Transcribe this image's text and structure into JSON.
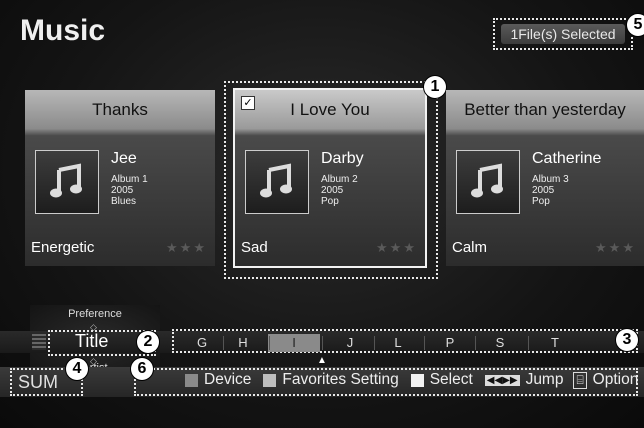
{
  "page_title": "Music",
  "selection_status": "1File(s) Selected",
  "callouts": {
    "c1": "1",
    "c2": "2",
    "c3": "3",
    "c4": "4",
    "c5": "5",
    "c6": "6"
  },
  "cards": [
    {
      "title": "Thanks",
      "artist": "Jee",
      "album": "Album 1",
      "year": "2005",
      "genre": "Blues",
      "mood": "Energetic",
      "stars": "★★★",
      "checked": false
    },
    {
      "title": "I Love You",
      "artist": "Darby",
      "album": "Album 2",
      "year": "2005",
      "genre": "Pop",
      "mood": "Sad",
      "stars": "★★★",
      "checked": true,
      "check_glyph": "✓"
    },
    {
      "title": "Better than yesterday",
      "artist": "Catherine",
      "album": "Album 3",
      "year": "2005",
      "genre": "Pop",
      "mood": "Calm",
      "stars": "★★★",
      "checked": false
    }
  ],
  "sort": {
    "prev": "Preference",
    "current": "Title",
    "next": "Artist"
  },
  "alphabet": {
    "letters": [
      "G",
      "H",
      "I",
      "J",
      "L",
      "P",
      "S",
      "T"
    ],
    "active": "I"
  },
  "footer": {
    "sum_label": "SUM",
    "items": [
      {
        "key": "device",
        "label": "Device",
        "color": "#8a8a8a",
        "icon": "gray-square-icon"
      },
      {
        "key": "favorites",
        "label": "Favorites Setting",
        "color": "#bdbdbd",
        "icon": "light-gray-square-icon"
      },
      {
        "key": "select",
        "label": "Select",
        "color": "#f2f2f2",
        "icon": "white-square-icon"
      },
      {
        "key": "jump",
        "label": "Jump",
        "icon": "rewind-forward-icon"
      },
      {
        "key": "option",
        "label": "Option",
        "icon": "tools-icon"
      }
    ]
  },
  "colors": {
    "accent_active_letter": "#8a8a8a",
    "dotted_outline": "#e8e8e8"
  }
}
